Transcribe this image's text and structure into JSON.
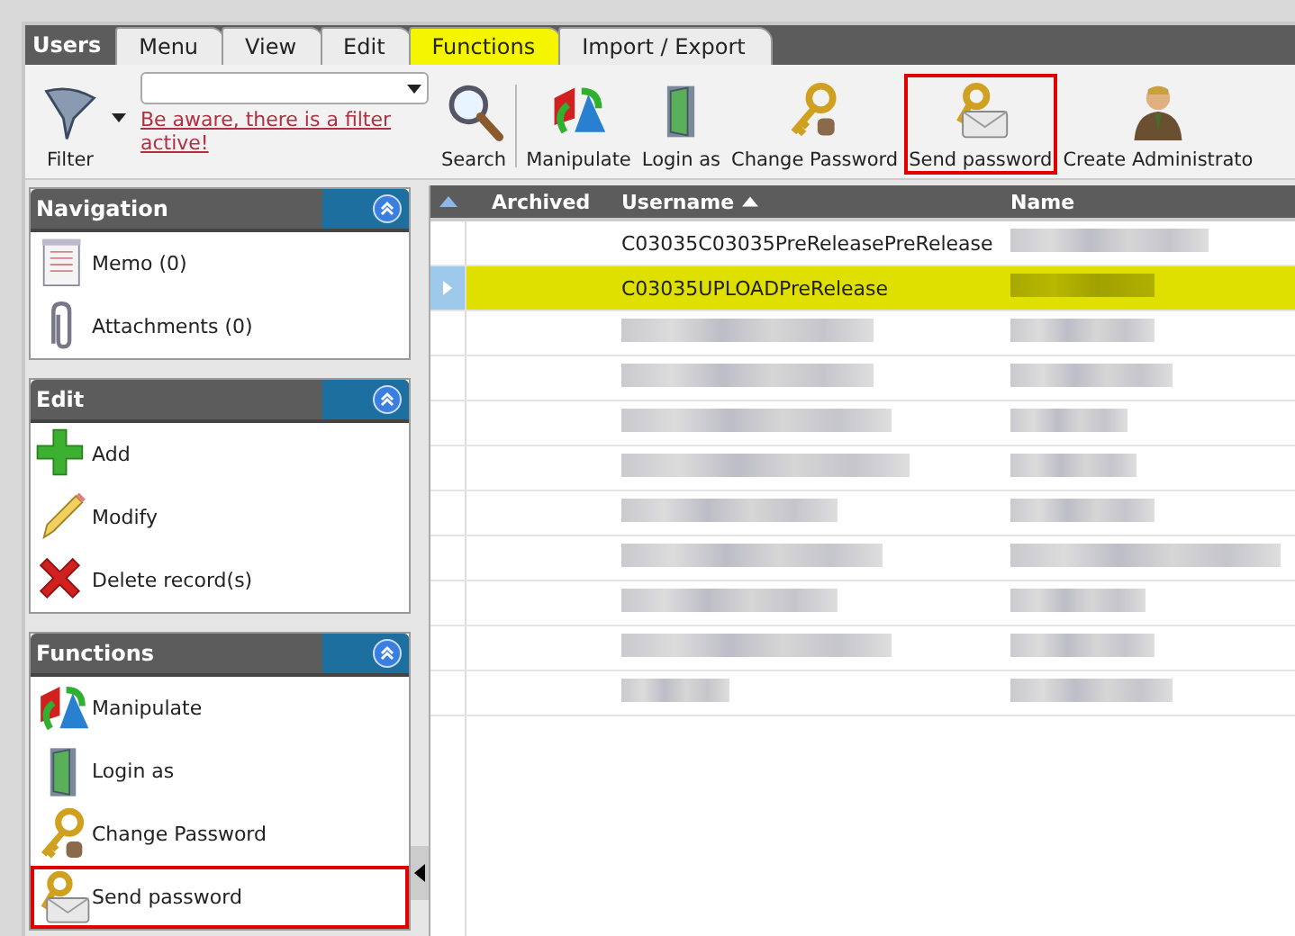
{
  "app_tabs": {
    "title": "Users",
    "tabs": [
      {
        "label": "Menu",
        "selected": false
      },
      {
        "label": "View",
        "selected": false
      },
      {
        "label": "Edit",
        "selected": false
      },
      {
        "label": "Functions",
        "selected": true
      },
      {
        "label": "Import / Export",
        "selected": false
      }
    ]
  },
  "toolbar": {
    "filter": {
      "label": "Filter"
    },
    "filter_warning": "Be aware, there is a filter active!",
    "search": {
      "label": "Search"
    },
    "actions": [
      {
        "kind": "manipulate",
        "label": "Manipulate",
        "highlighted": false
      },
      {
        "kind": "login",
        "label": "Login as",
        "highlighted": false
      },
      {
        "kind": "key",
        "label": "Change Password",
        "highlighted": false
      },
      {
        "kind": "sendkey",
        "label": "Send password",
        "highlighted": true
      },
      {
        "kind": "admin",
        "label": "Create Administrato",
        "highlighted": false
      }
    ]
  },
  "sidebar": {
    "panels": [
      {
        "title": "Navigation",
        "items": [
          {
            "kind": "memo",
            "label": "Memo (0)",
            "highlighted": false
          },
          {
            "kind": "clip",
            "label": "Attachments (0)",
            "highlighted": false
          }
        ]
      },
      {
        "title": "Edit",
        "items": [
          {
            "kind": "add",
            "label": "Add",
            "highlighted": false
          },
          {
            "kind": "pencil",
            "label": "Modify",
            "highlighted": false
          },
          {
            "kind": "delete",
            "label": "Delete record(s)",
            "highlighted": false
          }
        ]
      },
      {
        "title": "Functions",
        "items": [
          {
            "kind": "manipulate",
            "label": "Manipulate",
            "highlighted": false
          },
          {
            "kind": "login",
            "label": "Login as",
            "highlighted": false
          },
          {
            "kind": "key",
            "label": "Change Password",
            "highlighted": false
          },
          {
            "kind": "sendkey",
            "label": "Send password",
            "highlighted": true
          }
        ]
      }
    ]
  },
  "table": {
    "columns": [
      {
        "label": "Archived",
        "sorted": false
      },
      {
        "label": "Username",
        "sorted": true
      },
      {
        "label": "Name",
        "sorted": false
      }
    ],
    "rows": [
      {
        "selected": false,
        "username": {
          "text": "C03035C03035PreReleasePreRelease"
        },
        "name": {
          "redacted": true
        }
      },
      {
        "selected": true,
        "username": {
          "text": "C03035UPLOADPreRelease"
        },
        "name": {
          "redacted": true
        }
      },
      {
        "selected": false,
        "username": {
          "redacted": true
        },
        "name": {
          "redacted": true
        }
      },
      {
        "selected": false,
        "username": {
          "redacted": true
        },
        "name": {
          "redacted": true
        }
      },
      {
        "selected": false,
        "username": {
          "redacted": true
        },
        "name": {
          "redacted": true
        }
      },
      {
        "selected": false,
        "username": {
          "redacted": true
        },
        "name": {
          "redacted": true
        }
      },
      {
        "selected": false,
        "username": {
          "redacted": true
        },
        "name": {
          "redacted": true
        }
      },
      {
        "selected": false,
        "username": {
          "redacted": true
        },
        "name": {
          "redacted": true
        }
      },
      {
        "selected": false,
        "username": {
          "redacted": true
        },
        "name": {
          "redacted": true
        }
      },
      {
        "selected": false,
        "username": {
          "redacted": true
        },
        "name": {
          "redacted": true
        }
      },
      {
        "selected": false,
        "username": {
          "redacted": true
        },
        "name": {
          "redacted": true
        }
      }
    ]
  }
}
